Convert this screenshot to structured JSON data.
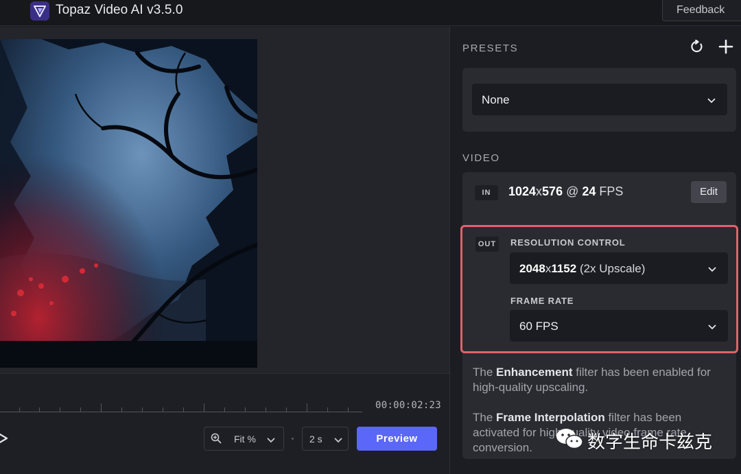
{
  "app": {
    "title": "Topaz Video AI  v3.5.0"
  },
  "header": {
    "feedback_label": "Feedback"
  },
  "timeline": {
    "timecode": "00:00:02:23",
    "zoom_label": "Fit %",
    "duration_label": "2 s",
    "preview_label": "Preview"
  },
  "presets": {
    "heading": "PRESETS",
    "selected": "None"
  },
  "video": {
    "heading": "VIDEO",
    "in_badge": "IN",
    "in_width": "1024",
    "in_x": "x",
    "in_height": "576",
    "in_at": " @ ",
    "in_fps": "24",
    "in_fps_unit": " FPS",
    "edit_label": "Edit",
    "out_badge": "OUT",
    "resolution_label": "RESOLUTION CONTROL",
    "out_res_bold": "2048",
    "out_res_x": "x",
    "out_res_h": "1152",
    "out_res_note": " (2x Upscale)",
    "frame_rate_label": "FRAME RATE",
    "frame_rate_value": "60 FPS"
  },
  "info": {
    "p1_pre": "The ",
    "p1_bold": "Enhancement",
    "p1_post": " filter has been enabled for high-quality upscaling.",
    "p2_pre": "The ",
    "p2_bold": "Frame Interpolation",
    "p2_post": " filter has been activated for high-quality video frame rate conversion."
  },
  "watermark": {
    "text": "数字生命卡兹克"
  },
  "colors": {
    "accent": "#5b67f8",
    "highlight_border": "#e0626c",
    "background": "#1c1d22"
  }
}
